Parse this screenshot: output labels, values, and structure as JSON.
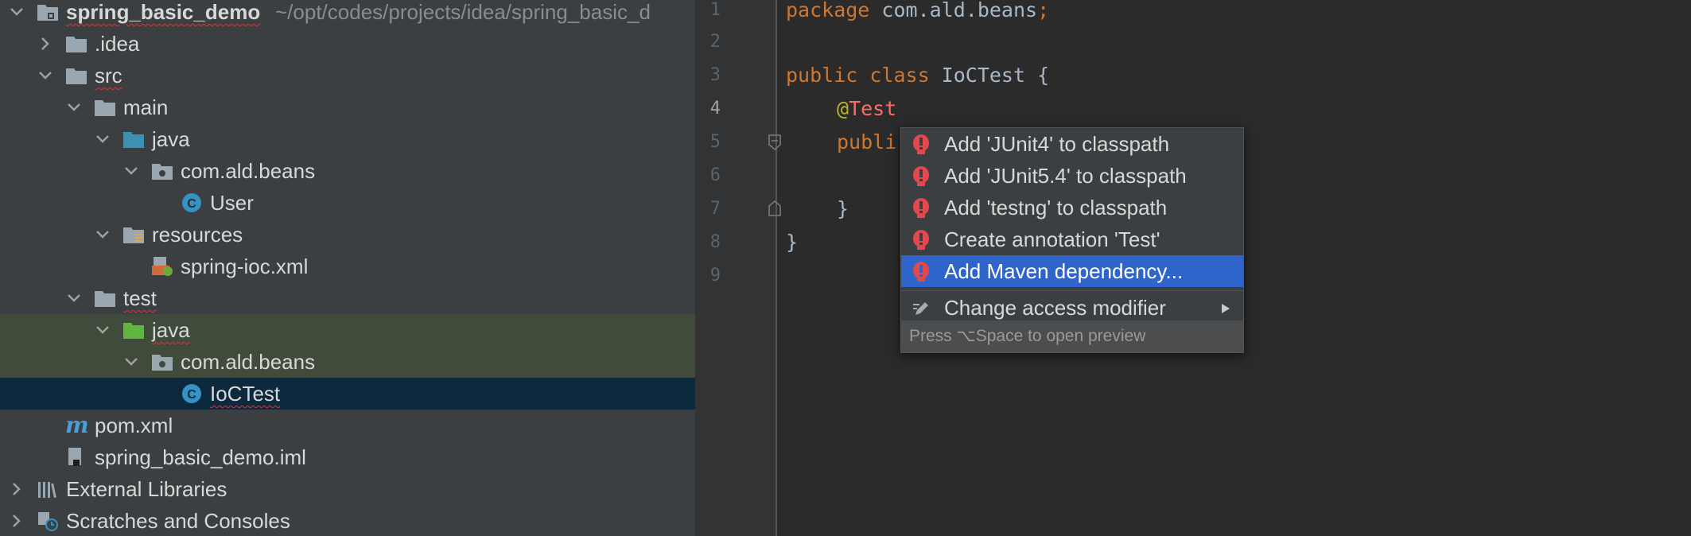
{
  "project_tree": {
    "root": {
      "name": "spring_basic_demo",
      "path": "~/opt/codes/projects/idea/spring_basic_d"
    },
    "items": [
      {
        "label": ".idea"
      },
      {
        "label": "src"
      },
      {
        "label": "main"
      },
      {
        "label": "java"
      },
      {
        "label": "com.ald.beans"
      },
      {
        "label": "User"
      },
      {
        "label": "resources"
      },
      {
        "label": "spring-ioc.xml"
      },
      {
        "label": "test"
      },
      {
        "label": "java"
      },
      {
        "label": "com.ald.beans"
      },
      {
        "label": "IoCTest"
      },
      {
        "label": "pom.xml"
      },
      {
        "label": "spring_basic_demo.iml"
      },
      {
        "label": "External Libraries"
      },
      {
        "label": "Scratches and Consoles"
      }
    ]
  },
  "editor": {
    "line_numbers": [
      "1",
      "2",
      "3",
      "4",
      "5",
      "6",
      "7",
      "8",
      "9"
    ],
    "lines": {
      "l1_kw": "package",
      "l1_rest": " com.ald.beans",
      "l1_semi": ";",
      "l3_kw": "public class",
      "l3_cls": " IoCTest",
      "l3_rest": " {",
      "l4_at": "@",
      "l4_ann": "Test",
      "l5_kw": "publi",
      "l7": "}",
      "l8": "}"
    }
  },
  "intention_popup": {
    "items": [
      {
        "label": "Add 'JUnit4' to classpath"
      },
      {
        "label": "Add 'JUnit5.4' to classpath"
      },
      {
        "label": "Add 'testng' to classpath"
      },
      {
        "label": "Create annotation 'Test'"
      },
      {
        "label": "Add Maven dependency..."
      },
      {
        "label": "Change access modifier"
      }
    ],
    "hint": "Press ⌥Space to open preview"
  },
  "colors": {
    "selection": "#2f65ca",
    "tree_selection": "#0d293e",
    "keyword": "#cc7832",
    "error": "#ff6b68"
  }
}
